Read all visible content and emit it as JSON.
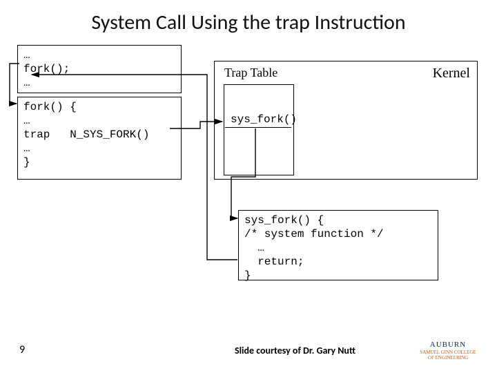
{
  "title": "System Call Using the trap Instruction",
  "user_top_code": "…\nfork();\n…",
  "user_bot_code": "fork() {\n…\ntrap   N_SYS_FORK()\n…\n}",
  "kernel_label": "Kernel",
  "trap_table_label": "Trap Table",
  "sys_fork_entry": "sys_fork()",
  "sys_fork_code": "sys_fork() {\n/* system function */\n  …\n  return;\n}",
  "slide_number": "9",
  "courtesy": "Slide courtesy of Dr. Gary Nutt",
  "logo": {
    "name": "AUBURN",
    "sub": "SAMUEL GINN\nCOLLEGE OF ENGINEERING"
  }
}
